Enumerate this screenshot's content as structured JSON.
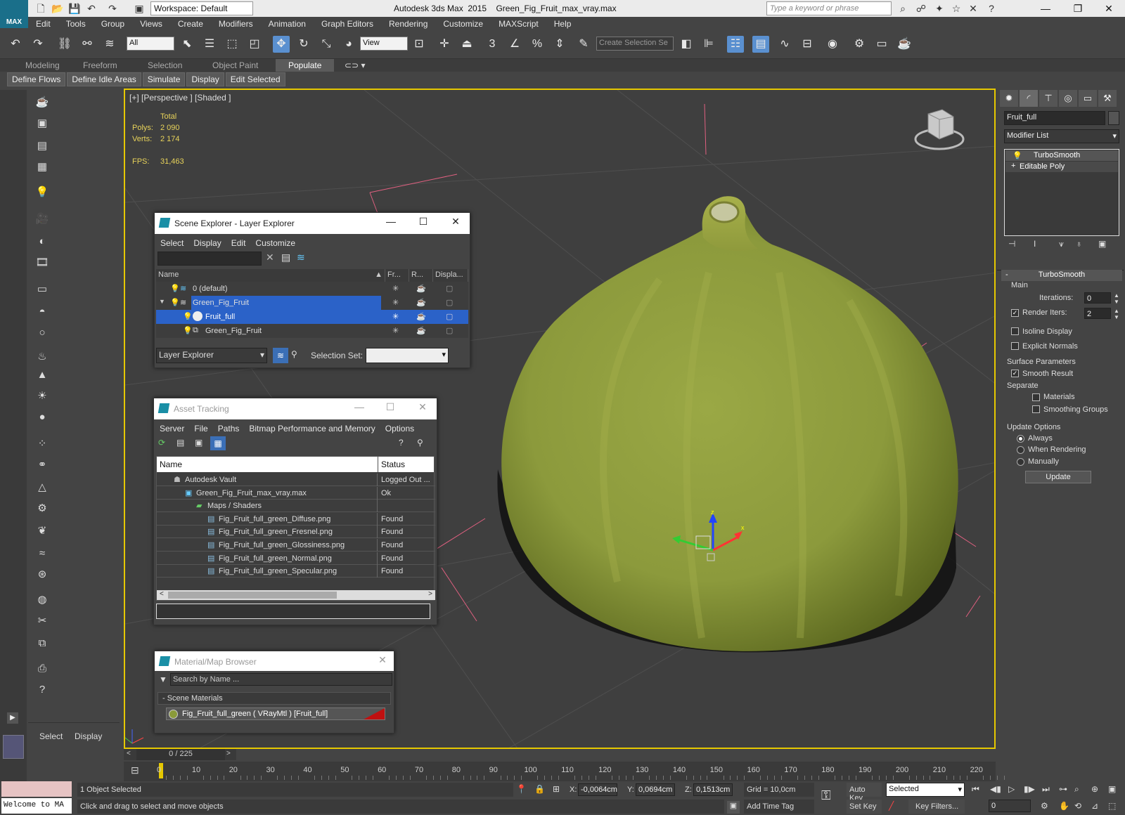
{
  "titlebar": {
    "app_title": "Autodesk 3ds Max  2015",
    "file_name": "Green_Fig_Fruit_max_vray.max",
    "workspace": "Workspace: Default",
    "search_placeholder": "Type a keyword or phrase"
  },
  "logo_text": "MAX",
  "menu": [
    "Edit",
    "Tools",
    "Group",
    "Views",
    "Create",
    "Modifiers",
    "Animation",
    "Graph Editors",
    "Rendering",
    "Customize",
    "MAXScript",
    "Help"
  ],
  "toolbar": {
    "selection_filter": "All",
    "ref_coord": "View",
    "named_selection_placeholder": "Create Selection Se",
    "snap_3": "3"
  },
  "ribbon_tabs": [
    "Modeling",
    "Freeform",
    "Selection",
    "Object Paint",
    "Populate"
  ],
  "ribbon_active": "Populate",
  "ribbon_buttons": [
    "Define Flows",
    "Define Idle Areas",
    "Simulate",
    "Display",
    "Edit Selected"
  ],
  "viewport": {
    "label": "[+] [Perspective ] [Shaded ]",
    "total_label": "Total",
    "polys_label": "Polys:",
    "polys_value": "2 090",
    "verts_label": "Verts:",
    "verts_value": "2 174",
    "fps_label": "FPS:",
    "fps_value": "31,463",
    "gizmo_x": "x",
    "gizmo_z": "z"
  },
  "scene_explorer": {
    "title": "Scene Explorer - Layer Explorer",
    "menu": [
      "Select",
      "Display",
      "Edit",
      "Customize"
    ],
    "columns": [
      "Name",
      "Fr...",
      "R...",
      "Displa..."
    ],
    "rows": [
      {
        "name": "0 (default)"
      },
      {
        "name": "Green_Fig_Fruit"
      },
      {
        "name": "Fruit_full"
      },
      {
        "name": "Green_Fig_Fruit"
      }
    ],
    "footer_dropdown": "Layer Explorer",
    "selection_set_label": "Selection Set:"
  },
  "asset_tracking": {
    "title": "Asset Tracking",
    "menu": [
      "Server",
      "File",
      "Paths",
      "Bitmap Performance and Memory",
      "Options"
    ],
    "columns": [
      "Name",
      "Status"
    ],
    "rows": [
      {
        "name": "Autodesk Vault",
        "status": "Logged Out ..."
      },
      {
        "name": "Green_Fig_Fruit_max_vray.max",
        "status": "Ok"
      },
      {
        "name": "Maps / Shaders",
        "status": ""
      },
      {
        "name": "Fig_Fruit_full_green_Diffuse.png",
        "status": "Found"
      },
      {
        "name": "Fig_Fruit_full_green_Fresnel.png",
        "status": "Found"
      },
      {
        "name": "Fig_Fruit_full_green_Glossiness.png",
        "status": "Found"
      },
      {
        "name": "Fig_Fruit_full_green_Normal.png",
        "status": "Found"
      },
      {
        "name": "Fig_Fruit_full_green_Specular.png",
        "status": "Found"
      }
    ]
  },
  "material_browser": {
    "title": "Material/Map Browser",
    "search_placeholder": "Search by Name ...",
    "section": "- Scene Materials",
    "material": "Fig_Fruit_full_green  ( VRayMtl )  [Fruit_full]"
  },
  "command_panel": {
    "object_name": "Fruit_full",
    "modifier_list": "Modifier List",
    "stack": [
      "TurboSmooth",
      "Editable Poly"
    ],
    "rollout_title": "TurboSmooth",
    "main_label": "Main",
    "iterations_label": "Iterations:",
    "iterations_value": "0",
    "render_iters_label": "Render Iters:",
    "render_iters_value": "2",
    "isoline_label": "Isoline Display",
    "explicit_label": "Explicit Normals",
    "surface_label": "Surface Parameters",
    "smooth_result_label": "Smooth Result",
    "separate_label": "Separate",
    "materials_label": "Materials",
    "smoothing_groups_label": "Smoothing Groups",
    "update_options_label": "Update Options",
    "always_label": "Always",
    "when_rendering_label": "When Rendering",
    "manually_label": "Manually",
    "update_button": "Update"
  },
  "left_bottom": {
    "select": "Select",
    "display": "Display"
  },
  "timeline": {
    "frame_counter": "0 / 225",
    "ticks": [
      "0",
      "10",
      "20",
      "30",
      "40",
      "50",
      "60",
      "70",
      "80",
      "90",
      "100",
      "110",
      "120",
      "130",
      "140",
      "150",
      "160",
      "170",
      "180",
      "190",
      "200",
      "210",
      "220"
    ]
  },
  "status": {
    "maxscript": "Welcome to MA",
    "selected": "1 Object Selected",
    "hint": "Click and drag to select and move objects",
    "x_label": "X:",
    "x_value": "-0,0064cm",
    "y_label": "Y:",
    "y_value": "0,0694cm",
    "z_label": "Z:",
    "z_value": "0,1513cm",
    "grid": "Grid = 10,0cm",
    "add_time_tag": "Add Time Tag",
    "auto_key": "Auto Key",
    "set_key": "Set Key",
    "key_mode": "Selected",
    "key_filters": "Key Filters...",
    "frame": "0"
  }
}
